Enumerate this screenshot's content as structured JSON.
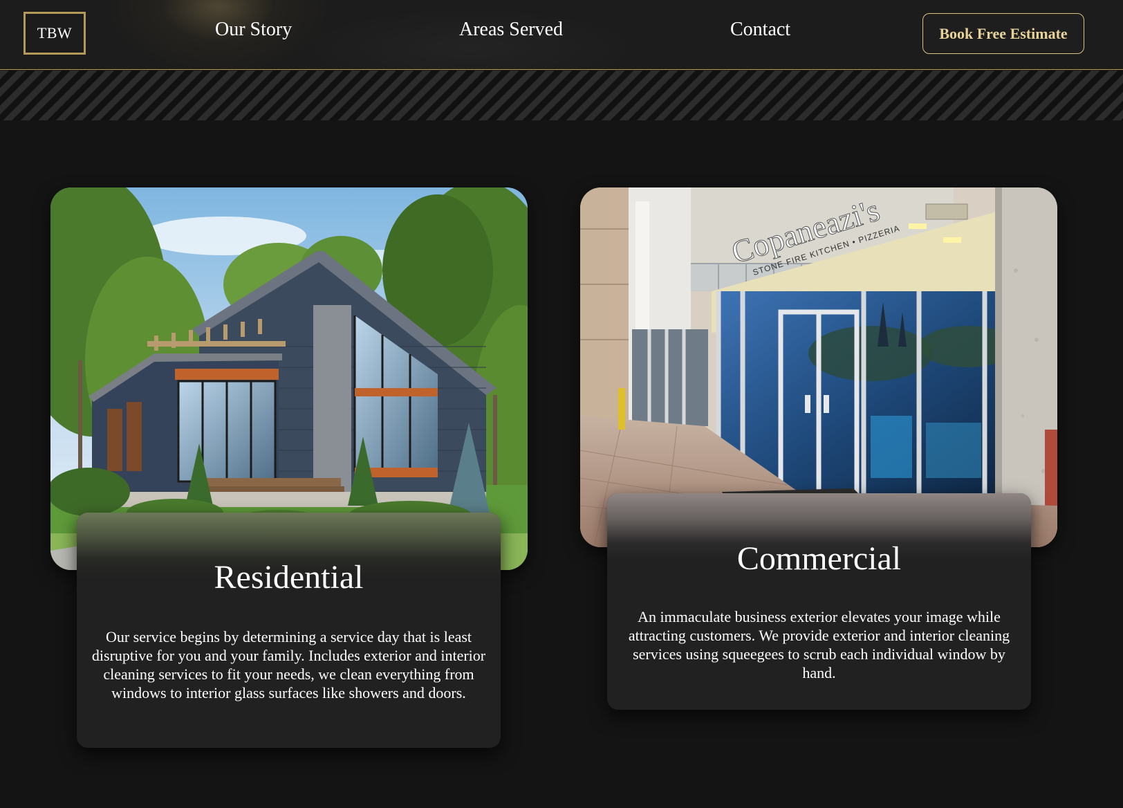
{
  "header": {
    "logo_text": "TBW",
    "nav": {
      "our_story": "Our Story",
      "areas_served": "Areas Served",
      "contact": "Contact"
    },
    "cta_label": "Book Free Estimate"
  },
  "services": {
    "residential": {
      "title": "Residential",
      "description": "Our service begins by determining a service day that is least disruptive for you and your family. Includes exterior and interior cleaning services to fit your needs, we clean everything from windows to interior glass surfaces like showers and doors."
    },
    "commercial": {
      "title": "Commercial",
      "description": "An immaculate business exterior elevates your image while attracting customers. We provide exterior and interior cleaning services using squeegees to scrub each individual window by hand.",
      "storefront_sign": "Copaneazi's",
      "storefront_subsign": "STONE FIRE KITCHEN • PIZZERIA"
    }
  },
  "colors": {
    "gold": "#b39a5a",
    "cta_text": "#e7d29a",
    "background": "#141414",
    "panel": "#212121"
  }
}
